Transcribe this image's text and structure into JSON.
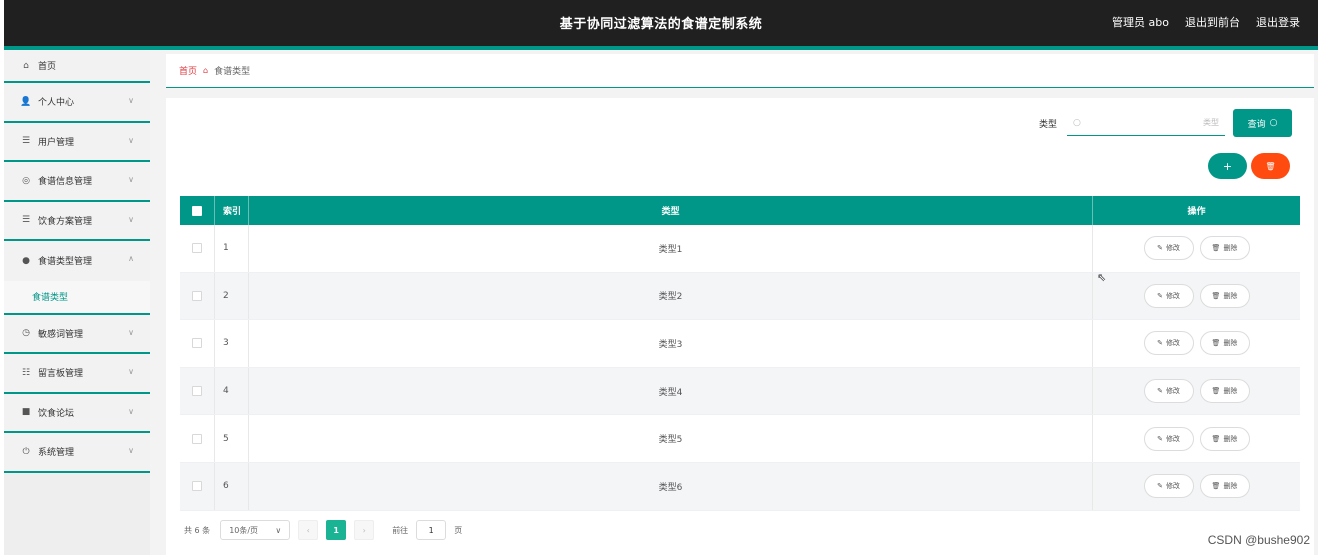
{
  "header": {
    "title": "基于协同过滤算法的食谱定制系统",
    "admin": "管理员 abo",
    "to_front": "退出到前台",
    "logout": "退出登录"
  },
  "sidebar": {
    "items": [
      {
        "label": "首页",
        "icon": "home-icon",
        "chev": ""
      },
      {
        "label": "个人中心",
        "icon": "user-icon",
        "chev": "∨"
      },
      {
        "label": "用户管理",
        "icon": "list-icon",
        "chev": "∨"
      },
      {
        "label": "食谱信息管理",
        "icon": "circle-icon",
        "chev": "∨"
      },
      {
        "label": "饮食方案管理",
        "icon": "list-icon",
        "chev": "∨"
      },
      {
        "label": "食谱类型管理",
        "icon": "pin-icon",
        "chev": "∧"
      },
      {
        "label": "敏感词管理",
        "icon": "clock-icon",
        "chev": "∨"
      },
      {
        "label": "留言板管理",
        "icon": "sliders-icon",
        "chev": "∨"
      },
      {
        "label": "饮食论坛",
        "icon": "chat-icon",
        "chev": "∨"
      },
      {
        "label": "系统管理",
        "icon": "power-icon",
        "chev": "∨"
      }
    ],
    "sub_item": "食谱类型"
  },
  "breadcrumb": {
    "home": "首页",
    "current": "食谱类型"
  },
  "search": {
    "label": "类型",
    "placeholder": "类型",
    "button": "查询"
  },
  "buttons": {
    "add": "+",
    "delete": "🗑"
  },
  "table": {
    "headers": {
      "index": "索引",
      "type": "类型",
      "op": "操作"
    },
    "rows": [
      {
        "index": "1",
        "type": "类型1"
      },
      {
        "index": "2",
        "type": "类型2"
      },
      {
        "index": "3",
        "type": "类型3"
      },
      {
        "index": "4",
        "type": "类型4"
      },
      {
        "index": "5",
        "type": "类型5"
      },
      {
        "index": "6",
        "type": "类型6"
      }
    ],
    "edit_label": "修改",
    "delete_label": "删除"
  },
  "pagination": {
    "total": "共 6 条",
    "page_size": "10条/页",
    "current_page": "1",
    "goto_label": "前往",
    "goto_value": "1",
    "page_suffix": "页"
  },
  "watermark": "CSDN @bushe902"
}
